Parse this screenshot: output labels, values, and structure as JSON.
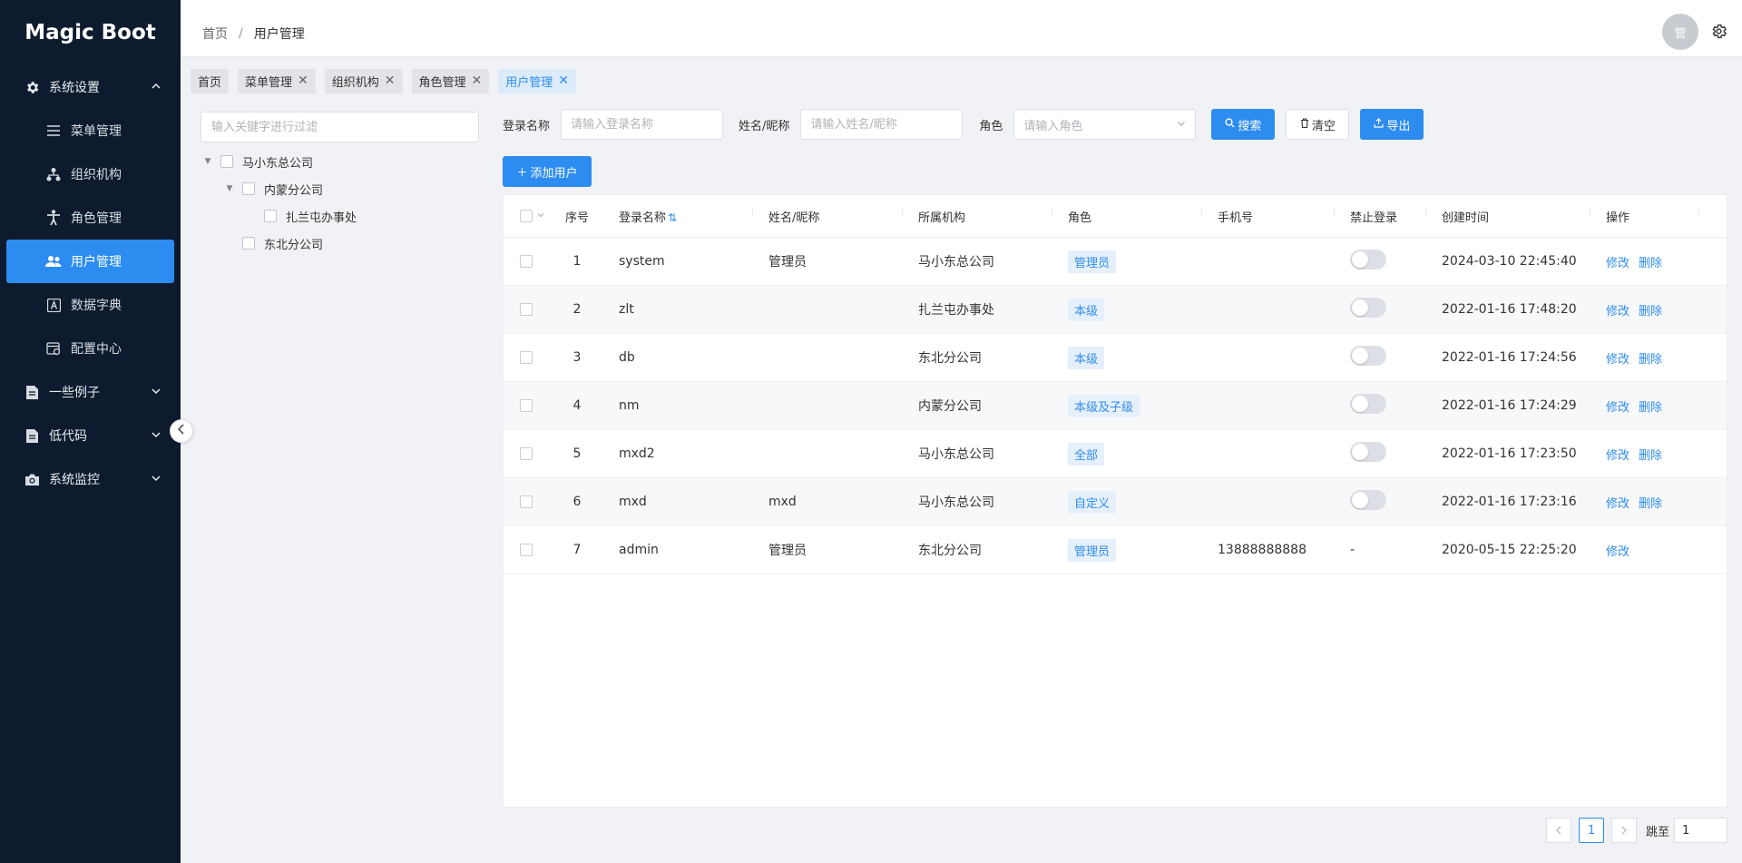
{
  "app": {
    "logo": "Magic Boot"
  },
  "sidebar": {
    "groups": [
      {
        "label": "系统设置",
        "icon": "gear-icon",
        "expanded": true
      },
      {
        "label": "一些例子",
        "icon": "document-icon",
        "expanded": false
      },
      {
        "label": "低代码",
        "icon": "document-icon",
        "expanded": false
      },
      {
        "label": "系统监控",
        "icon": "camera-icon",
        "expanded": false
      }
    ],
    "items": [
      {
        "label": "菜单管理",
        "icon": "menu-icon"
      },
      {
        "label": "组织机构",
        "icon": "org-icon"
      },
      {
        "label": "角色管理",
        "icon": "person-icon"
      },
      {
        "label": "用户管理",
        "icon": "users-icon",
        "active": true
      },
      {
        "label": "数据字典",
        "icon": "dictionary-icon"
      },
      {
        "label": "配置中心",
        "icon": "config-icon"
      }
    ]
  },
  "header": {
    "breadcrumb": [
      "首页",
      "用户管理"
    ],
    "breadcrumb_sep": "/",
    "avatar_text": "管"
  },
  "tabs": [
    {
      "label": "首页",
      "closable": false
    },
    {
      "label": "菜单管理",
      "closable": true
    },
    {
      "label": "组织机构",
      "closable": true
    },
    {
      "label": "角色管理",
      "closable": true
    },
    {
      "label": "用户管理",
      "closable": true,
      "active": true
    }
  ],
  "tree": {
    "filter_placeholder": "输入关键字进行过滤",
    "nodes": [
      {
        "label": "马小东总公司",
        "level": 0
      },
      {
        "label": "内蒙分公司",
        "level": 1
      },
      {
        "label": "扎兰屯办事处",
        "level": 2
      },
      {
        "label": "东北分公司",
        "level": 1
      }
    ]
  },
  "search": {
    "login_label": "登录名称",
    "login_placeholder": "请输入登录名称",
    "name_label": "姓名/昵称",
    "name_placeholder": "请输入姓名/昵称",
    "role_label": "角色",
    "role_placeholder": "请输入角色",
    "search_btn": "搜索",
    "clear_btn": "清空",
    "export_btn": "导出",
    "add_btn": "添加用户"
  },
  "table": {
    "columns": [
      "序号",
      "登录名称",
      "姓名/昵称",
      "所属机构",
      "角色",
      "手机号",
      "禁止登录",
      "创建时间",
      "操作"
    ],
    "rows": [
      {
        "no": "1",
        "login": "system",
        "name": "管理员",
        "org": "马小东总公司",
        "role": "管理员",
        "phone": "",
        "ban": "switch",
        "time": "2024-03-10 22:45:40",
        "ops": [
          "修改",
          "删除"
        ]
      },
      {
        "no": "2",
        "login": "zlt",
        "name": "",
        "org": "扎兰屯办事处",
        "role": "本级",
        "phone": "",
        "ban": "switch",
        "time": "2022-01-16 17:48:20",
        "ops": [
          "修改",
          "删除"
        ]
      },
      {
        "no": "3",
        "login": "db",
        "name": "",
        "org": "东北分公司",
        "role": "本级",
        "phone": "",
        "ban": "switch",
        "time": "2022-01-16 17:24:56",
        "ops": [
          "修改",
          "删除"
        ]
      },
      {
        "no": "4",
        "login": "nm",
        "name": "",
        "org": "内蒙分公司",
        "role": "本级及子级",
        "phone": "",
        "ban": "switch",
        "time": "2022-01-16 17:24:29",
        "ops": [
          "修改",
          "删除"
        ]
      },
      {
        "no": "5",
        "login": "mxd2",
        "name": "",
        "org": "马小东总公司",
        "role": "全部",
        "phone": "",
        "ban": "switch",
        "time": "2022-01-16 17:23:50",
        "ops": [
          "修改",
          "删除"
        ]
      },
      {
        "no": "6",
        "login": "mxd",
        "name": "mxd",
        "org": "马小东总公司",
        "role": "自定义",
        "phone": "",
        "ban": "switch",
        "time": "2022-01-16 17:23:16",
        "ops": [
          "修改",
          "删除"
        ]
      },
      {
        "no": "7",
        "login": "admin",
        "name": "管理员",
        "org": "东北分公司",
        "role": "管理员",
        "phone": "13888888888",
        "ban": "-",
        "time": "2020-05-15 22:25:20",
        "ops": [
          "修改"
        ]
      }
    ]
  },
  "pager": {
    "current": "1",
    "jump_label": "跳至",
    "jump_value": "1"
  },
  "colors": {
    "primary": "#2d8cf0",
    "sidebar_bg": "#0e1b2e"
  }
}
